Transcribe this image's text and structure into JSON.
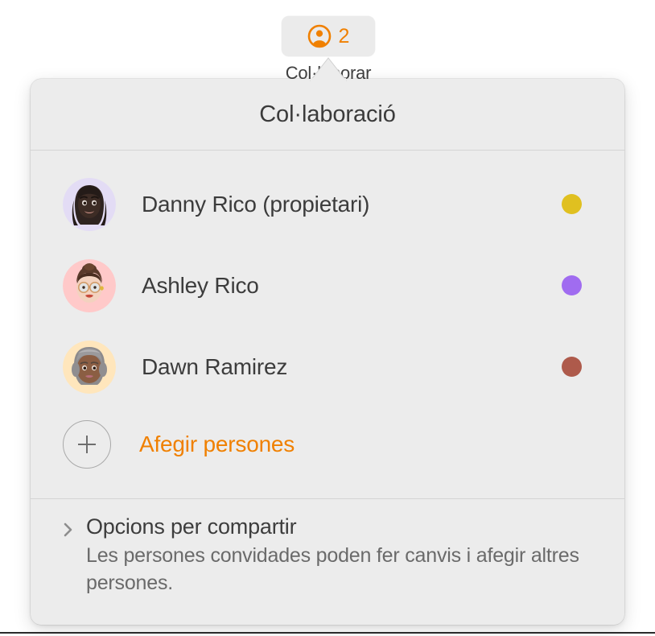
{
  "toolbar": {
    "collab_button_label": "Col·laborar",
    "collab_count": "2",
    "person_icon_color": "#F08000",
    "count_color": "#F08000"
  },
  "popover": {
    "title": "Col·laboració",
    "people": [
      {
        "name": "Danny Rico (propietari)",
        "dot_color": "#E0C020",
        "avatar_bg": "#E3DCF5",
        "avatar_kind": "memoji-danny"
      },
      {
        "name": "Ashley Rico",
        "dot_color": "#A06CF0",
        "avatar_bg": "#FFC9C9",
        "avatar_kind": "memoji-ashley"
      },
      {
        "name": "Dawn Ramirez",
        "dot_color": "#AE5A4B",
        "avatar_bg": "#FFE6BC",
        "avatar_kind": "memoji-dawn"
      }
    ],
    "add_people_label": "Afegir persones",
    "add_people_color": "#F08000",
    "share_options": {
      "title": "Opcions per compartir",
      "description": "Les persones convidades poden fer canvis i afegir altres persones."
    }
  }
}
